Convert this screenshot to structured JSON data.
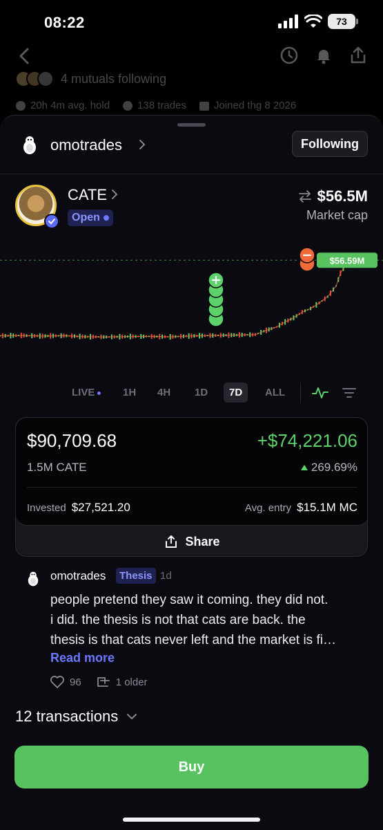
{
  "status_bar": {
    "time": "08:22",
    "battery": "73"
  },
  "background": {
    "mutuals_text": "4 mutuals following",
    "avg_hold": "20h 4m avg. hold",
    "trades": "138 trades",
    "joined": "Joined thg 8 2026"
  },
  "profile": {
    "name": "omotrades",
    "follow_label": "Following"
  },
  "token": {
    "name": "CATE",
    "status": "Open",
    "market_cap": "$56.5M",
    "market_cap_label": "Market cap"
  },
  "chart_data": {
    "type": "line",
    "price_tag": "$56.59M",
    "x": [
      0,
      5,
      10,
      15,
      20,
      25,
      30,
      35,
      40,
      45,
      50,
      55,
      60,
      62,
      65,
      67,
      69,
      71,
      73,
      75,
      77,
      79,
      80,
      82
    ],
    "y": [
      5.4,
      5.6,
      5.2,
      5.5,
      4.8,
      4.6,
      4.9,
      5.0,
      4.7,
      5.3,
      5.6,
      5.9,
      6.2,
      8.5,
      11.4,
      14.8,
      17.6,
      21.5,
      23.9,
      27.6,
      31.9,
      39.2,
      47.8,
      56.59
    ],
    "buy_markers": 5,
    "sell_markers": 2,
    "colors": {
      "line": "#e86b3a",
      "up": "#5dd26a",
      "down": "#e0493f"
    }
  },
  "time_ranges": [
    "LIVE",
    "1H",
    "4H",
    "1D",
    "7D",
    "ALL"
  ],
  "active_range": "7D",
  "holdings": {
    "value": "$90,709.68",
    "pnl": "+$74,221.06",
    "amount": "1.5M CATE",
    "pnl_pct": "269.69%",
    "invested_label": "Invested",
    "invested_value": "$27,521.20",
    "entry_label": "Avg. entry",
    "entry_value": "$15.1M MC",
    "share_label": "Share"
  },
  "post": {
    "author": "omotrades",
    "tag": "Thesis",
    "time": "1d",
    "body": "people pretend they saw it coming. they did not.\ni did. the thesis is not that cats are back. the\nthesis is that cats never left and the market is fi…",
    "read_more": "Read more",
    "likes": "96",
    "older": "1 older"
  },
  "transactions_label": "12 transactions",
  "buy_label": "Buy"
}
